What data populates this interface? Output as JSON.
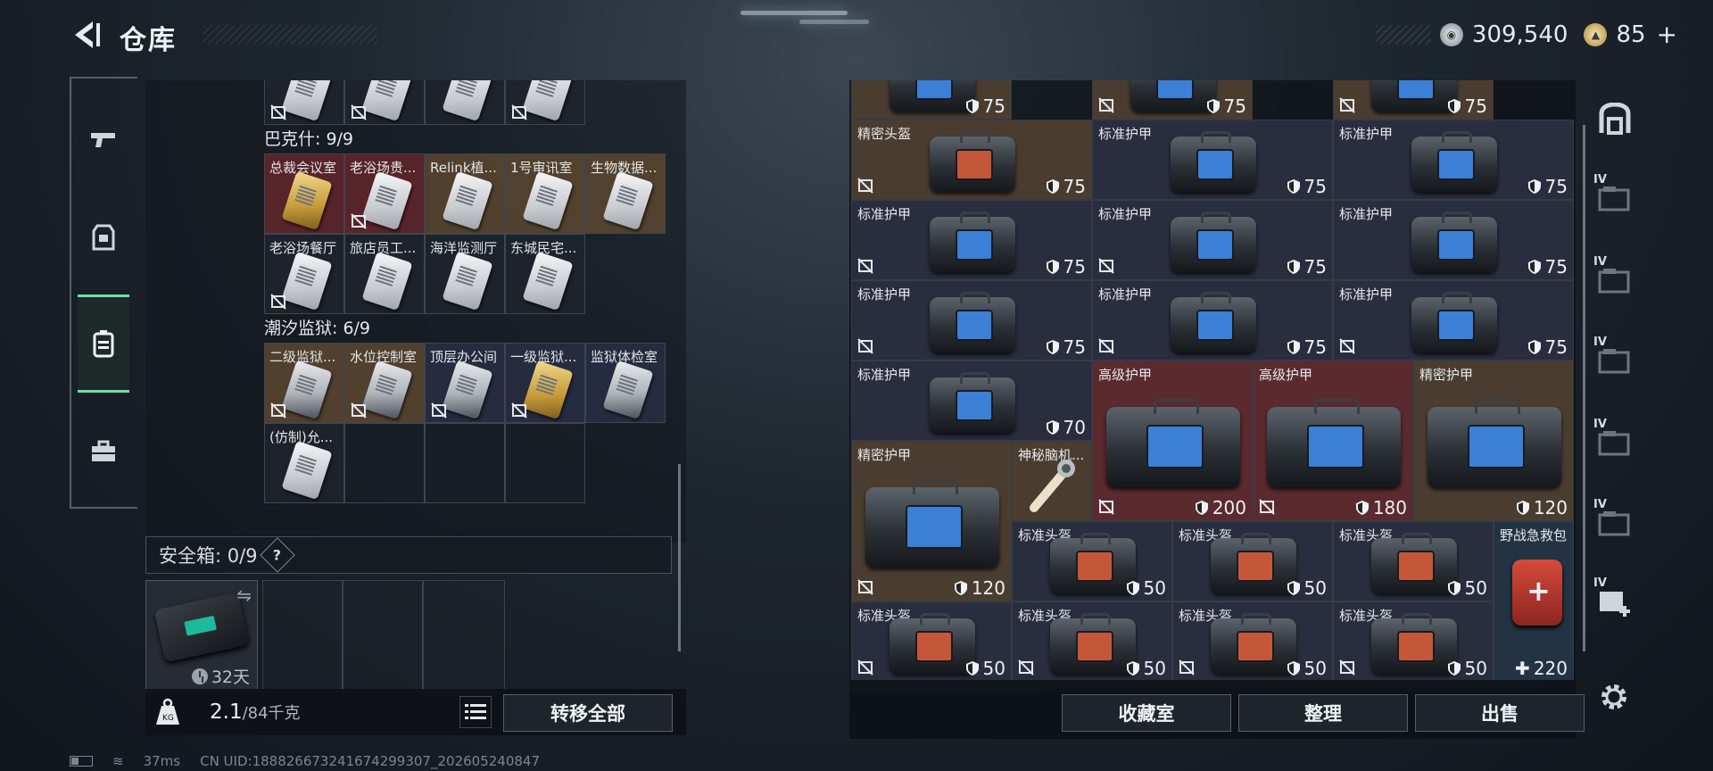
{
  "header": {
    "title": "仓库"
  },
  "currency": {
    "silver": "309,540",
    "gold": "85"
  },
  "left_tabs": [
    "weapons",
    "armor",
    "storage",
    "tools"
  ],
  "stash_groups": [
    {
      "label": "巴克什: 9/9",
      "items": [
        "总裁会议室",
        "老浴场贵...",
        "Relink植...",
        "1号审讯室",
        "生物数据...",
        "老浴场餐厅",
        "旅店员工...",
        "海洋监测厅",
        "东城民宅..."
      ]
    },
    {
      "label": "潮汐监狱: 6/9",
      "items": [
        "二级监狱...",
        "水位控制室",
        "顶层办公间",
        "一级监狱...",
        "监狱体检室",
        "(仿制)允..."
      ]
    }
  ],
  "safebox": {
    "label": "安全箱: 0/9",
    "help": "?",
    "days": "32天"
  },
  "bottom": {
    "weight_value": "2.1",
    "weight_total": "/84千克",
    "transfer_label": "转移全部"
  },
  "status": {
    "ping": "37ms",
    "uid": "CN UID:188826673241674299307_202605240847"
  },
  "armor_items": [
    {
      "name": "",
      "dur": "75"
    },
    {
      "name": "",
      "dur": "75"
    },
    {
      "name": "",
      "dur": "75"
    },
    {
      "name": "精密头盔",
      "dur": "75"
    },
    {
      "name": "标准护甲",
      "dur": "75"
    },
    {
      "name": "标准护甲",
      "dur": "75"
    },
    {
      "name": "标准护甲",
      "dur": "75"
    },
    {
      "name": "标准护甲",
      "dur": "75"
    },
    {
      "name": "标准护甲",
      "dur": "75"
    },
    {
      "name": "标准护甲",
      "dur": "75"
    },
    {
      "name": "标准护甲",
      "dur": "75"
    },
    {
      "name": "标准护甲",
      "dur": "75"
    },
    {
      "name": "标准护甲",
      "dur": "70"
    },
    {
      "name": "高级护甲",
      "dur": "200"
    },
    {
      "name": "高级护甲",
      "dur": "180"
    },
    {
      "name": "精密护甲",
      "dur": "120"
    },
    {
      "name": "精密护甲",
      "dur": "120"
    },
    {
      "name": "神秘脑机...",
      "dur": ""
    },
    {
      "name": "标准头盔",
      "dur": "50"
    },
    {
      "name": "标准头盔",
      "dur": "50"
    },
    {
      "name": "标准头盔",
      "dur": "50"
    },
    {
      "name": "野战急救包",
      "dur": "220"
    },
    {
      "name": "标准头盔",
      "dur": "50"
    },
    {
      "name": "标准头盔",
      "dur": "50"
    },
    {
      "name": "标准头盔",
      "dur": "50"
    },
    {
      "name": "标准头盔",
      "dur": "50"
    }
  ],
  "right_buttons": {
    "collection": "收藏室",
    "sort": "整理",
    "sell": "出售"
  },
  "right_icons": [
    {
      "icon": "armor-rack-icon",
      "lv": ""
    },
    {
      "icon": "stash-tab-icon",
      "lv": "IV"
    },
    {
      "icon": "stash-tab-icon",
      "lv": "IV"
    },
    {
      "icon": "stash-tab-icon",
      "lv": "IV"
    },
    {
      "icon": "stash-tab-icon",
      "lv": "IV"
    },
    {
      "icon": "stash-tab-icon",
      "lv": "IV"
    },
    {
      "icon": "stash-add-icon",
      "lv": "IV"
    }
  ],
  "colors": {
    "accent": "#6ee0a8",
    "cell_blue": "#2a2d3e",
    "cell_gold": "#4a3d30",
    "cell_red": "#5a2a2e"
  }
}
